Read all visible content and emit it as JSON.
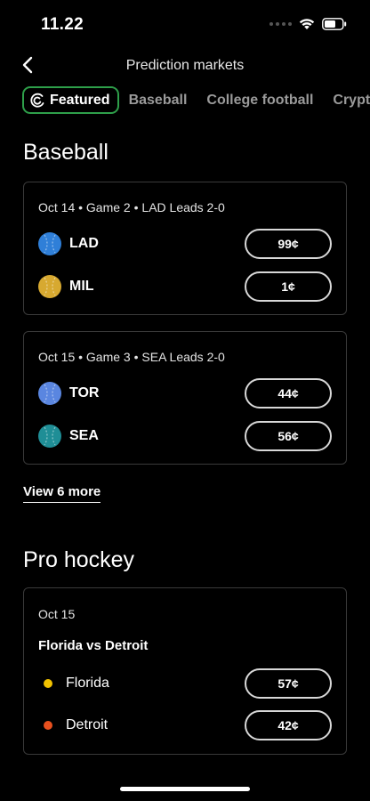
{
  "status_bar": {
    "time": "11.22"
  },
  "nav": {
    "title": "Prediction markets"
  },
  "tabs": [
    {
      "label": "Featured",
      "active": true,
      "icon": "featured-icon"
    },
    {
      "label": "Baseball",
      "active": false
    },
    {
      "label": "College football",
      "active": false
    },
    {
      "label": "Crypto",
      "active": false
    }
  ],
  "sections": {
    "baseball": {
      "title": "Baseball",
      "games": [
        {
          "header": "Oct 14 • Game 2 • LAD Leads 2-0",
          "teams": [
            {
              "name": "LAD",
              "price": "99¢",
              "color": "#2f7fd8"
            },
            {
              "name": "MIL",
              "price": "1¢",
              "color": "#d7a930"
            }
          ]
        },
        {
          "header": "Oct 15 • Game 3 • SEA Leads 2-0",
          "teams": [
            {
              "name": "TOR",
              "price": "44¢",
              "color": "#5a86e0"
            },
            {
              "name": "SEA",
              "price": "56¢",
              "color": "#1f8e96"
            }
          ]
        }
      ],
      "view_more": "View 6 more"
    },
    "pro_hockey": {
      "title": "Pro hockey",
      "games": [
        {
          "header": "Oct 15",
          "matchup": "Florida vs Detroit",
          "teams": [
            {
              "name": "Florida",
              "price": "57¢",
              "color": "#f2c200"
            },
            {
              "name": "Detroit",
              "price": "42¢",
              "color": "#e8501e"
            }
          ]
        }
      ]
    }
  }
}
